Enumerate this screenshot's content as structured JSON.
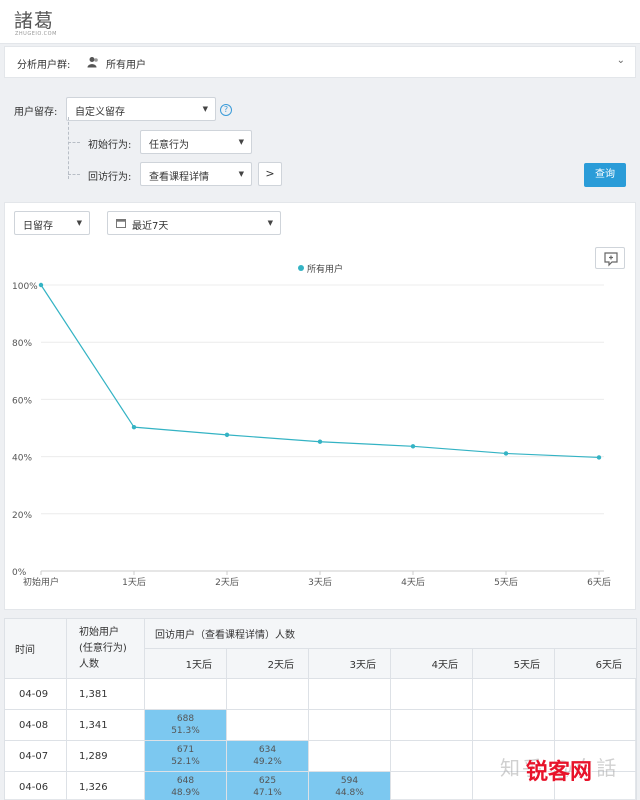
{
  "app": {
    "logo_text": "諸葛",
    "logo_sub": "ZHUGEIO.COM"
  },
  "segment": {
    "label": "分析用户群:",
    "value": "所有用户"
  },
  "config": {
    "retention_label": "用户留存:",
    "retention_type": "自定义留存",
    "help": "?",
    "initial_label": "初始行为:",
    "initial_value": "任意行为",
    "return_label": "回访行为:",
    "return_value": "查看课程详情",
    "next": ">",
    "query": "查询"
  },
  "chart_controls": {
    "granularity": "日留存",
    "date_range": "最近7天"
  },
  "chart_data": {
    "type": "line",
    "legend": "所有用户",
    "categories": [
      "初始用户",
      "1天后",
      "2天后",
      "3天后",
      "4天后",
      "5天后",
      "6天后"
    ],
    "series": [
      {
        "name": "所有用户",
        "values": [
          100,
          50.3,
          47.6,
          45.2,
          43.6,
          41.1,
          39.7
        ]
      }
    ],
    "y_ticks": [
      "0%",
      "20%",
      "40%",
      "60%",
      "80%",
      "100%"
    ],
    "ylim": [
      0,
      100
    ],
    "color": "#34b3c4",
    "grid": true,
    "legend_position": "top-center"
  },
  "table": {
    "col_date": "时间",
    "col_initial": "初始用户\n(任意行为)\n人数",
    "col_return": "回访用户（查看课程详情）人数",
    "days": [
      "1天后",
      "2天后",
      "3天后",
      "4天后",
      "5天后",
      "6天后"
    ],
    "rows": [
      {
        "date": "04-09",
        "initial": "1,381",
        "cells": []
      },
      {
        "date": "04-08",
        "initial": "1,341",
        "cells": [
          {
            "count": "688",
            "pct": "51.3%"
          }
        ]
      },
      {
        "date": "04-07",
        "initial": "1,289",
        "cells": [
          {
            "count": "671",
            "pct": "52.1%"
          },
          {
            "count": "634",
            "pct": "49.2%"
          }
        ]
      },
      {
        "date": "04-06",
        "initial": "1,326",
        "cells": [
          {
            "count": "648",
            "pct": "48.9%"
          },
          {
            "count": "625",
            "pct": "47.1%"
          },
          {
            "count": "594",
            "pct": "44.8%"
          }
        ]
      }
    ]
  },
  "watermark": {
    "text": "知乎 @白話",
    "logo": "锐客网"
  },
  "colors": {
    "accent": "#2a9cd8",
    "cell_fill": "#7cc8f0",
    "line": "#34b3c4"
  }
}
